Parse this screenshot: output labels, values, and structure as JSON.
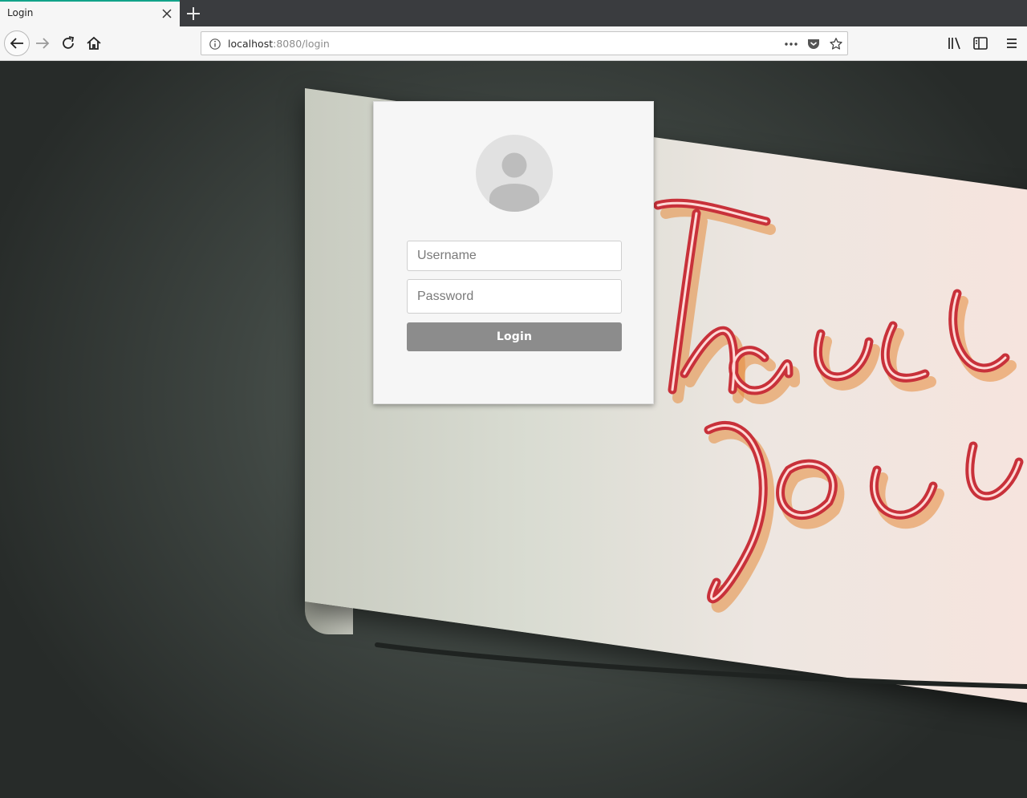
{
  "browser": {
    "tab": {
      "title": "Login"
    },
    "url": {
      "host": "localhost",
      "rest": ":8080/login"
    }
  },
  "login": {
    "username_placeholder": "Username",
    "password_placeholder": "Password",
    "button_label": "Login"
  },
  "colors": {
    "tab_accent": "#12a38a",
    "button_bg": "#8c8c8c",
    "card_bg": "#f6f6f6"
  },
  "icons": [
    "tab-close-icon",
    "new-tab-icon",
    "back-arrow-icon",
    "forward-arrow-icon",
    "reload-icon",
    "home-icon",
    "info-icon",
    "more-dots-icon",
    "pocket-icon",
    "bookmark-star-icon",
    "library-icon",
    "sidebar-icon",
    "hamburger-menu-icon",
    "avatar-icon"
  ]
}
